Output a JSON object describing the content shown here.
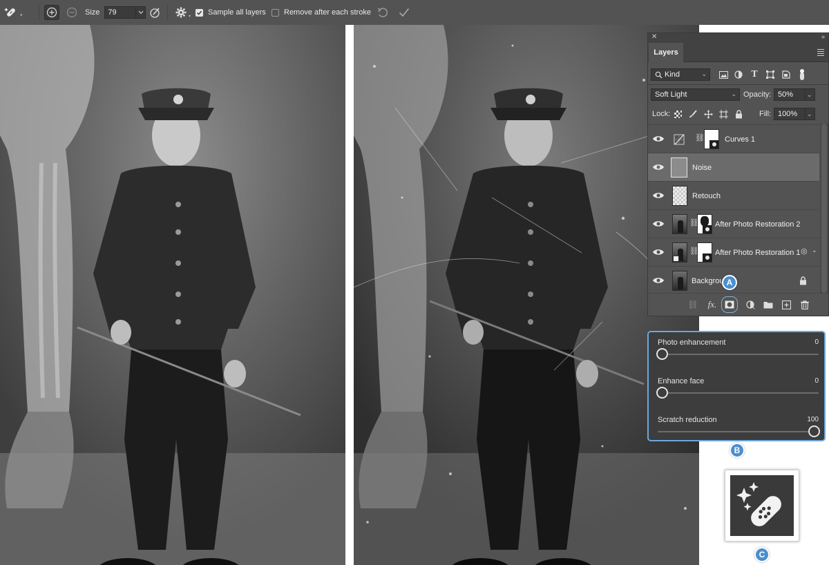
{
  "toolbar": {
    "size_label": "Size",
    "size_value": "79",
    "sample_all_layers_label": "Sample all layers",
    "sample_all_layers_checked": true,
    "remove_after_stroke_label": "Remove after each stroke",
    "remove_after_stroke_checked": false,
    "icons": [
      "spot-healing-brush-icon",
      "add-to-brush-icon",
      "subtract-from-brush-icon",
      "pressure-icon",
      "settings-gear-icon",
      "undo-stroke-icon",
      "commit-checkmark-icon"
    ]
  },
  "layers_panel": {
    "tab_label": "Layers",
    "filter_kind": "Kind",
    "blend_mode": "Soft Light",
    "opacity_label": "Opacity:",
    "opacity_value": "50%",
    "lock_label": "Lock:",
    "fill_label": "Fill:",
    "fill_value": "100%",
    "layers": [
      {
        "name": "Curves 1",
        "visible": true,
        "selected": false,
        "type": "adjustment"
      },
      {
        "name": "Noise",
        "visible": true,
        "selected": true,
        "type": "fill"
      },
      {
        "name": "Retouch",
        "visible": true,
        "selected": false,
        "type": "pixel"
      },
      {
        "name": "After Photo Restoration 2",
        "visible": true,
        "selected": false,
        "type": "masked"
      },
      {
        "name": "After Photo Restoration 1",
        "visible": true,
        "selected": false,
        "type": "masked-smart"
      },
      {
        "name": "Backgrou",
        "visible": true,
        "selected": false,
        "type": "background",
        "locked": true
      }
    ]
  },
  "filter_panel": {
    "sliders": [
      {
        "name": "Photo enhancement",
        "value": "0",
        "fraction": 0
      },
      {
        "name": "Enhance face",
        "value": "0",
        "fraction": 0
      },
      {
        "name": "Scratch reduction",
        "value": "100",
        "fraction": 1
      }
    ]
  },
  "callouts": {
    "a": "A",
    "b": "B",
    "c": "C"
  },
  "colors": {
    "accent": "#4a8fd0",
    "panel_bg": "#535353",
    "toolbar_bg": "#535353"
  }
}
